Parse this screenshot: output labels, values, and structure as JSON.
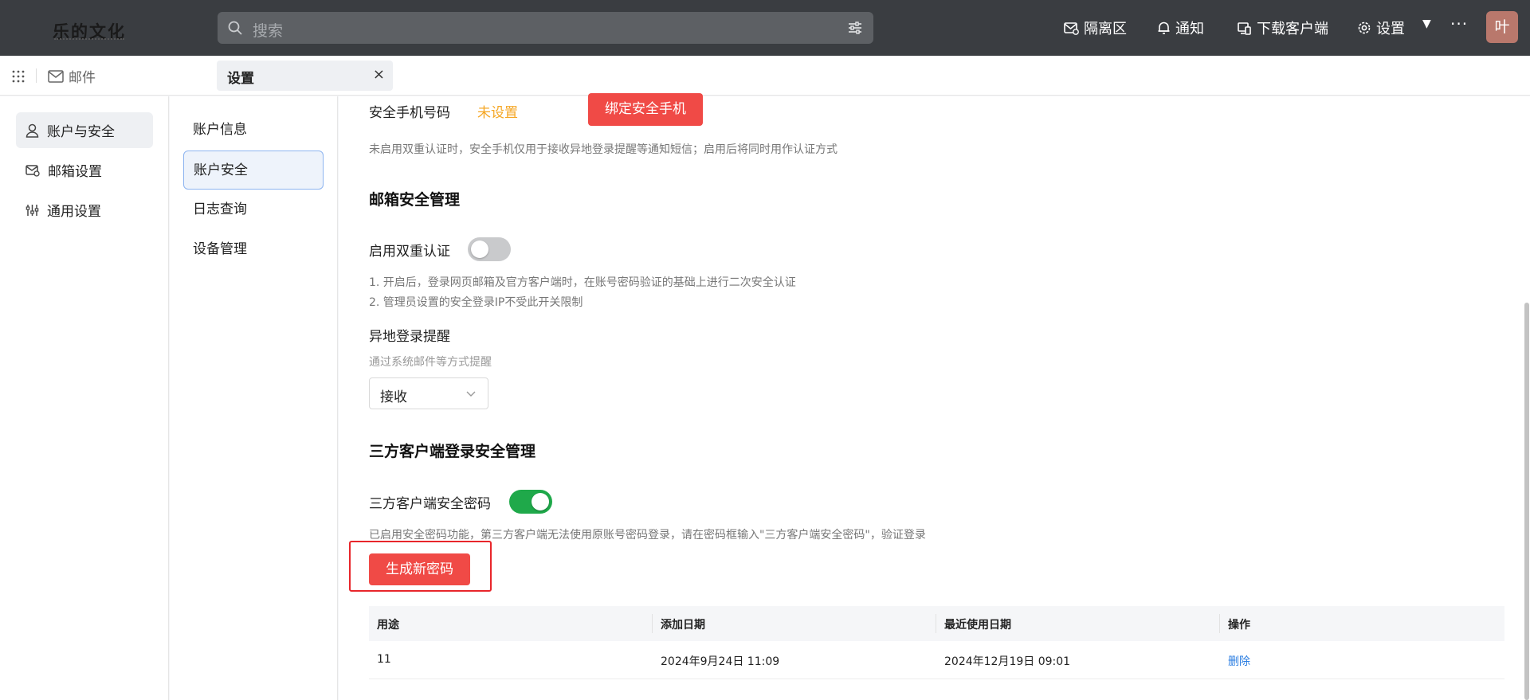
{
  "app": {
    "logo_text": "乐的文化",
    "search_placeholder": "搜索"
  },
  "top_nav": {
    "quarantine": "隔离区",
    "notifications": "通知",
    "download_client": "下载客户端",
    "settings": "设置",
    "more": "···",
    "avatar_initial": "叶"
  },
  "subbar": {
    "mail_tab": "邮件",
    "settings_tab": "设置",
    "close": "×"
  },
  "sidebar": {
    "items": [
      {
        "label": "账户与安全",
        "icon": "user-icon",
        "active": true
      },
      {
        "label": "邮箱设置",
        "icon": "mailbox-settings-icon",
        "active": false
      },
      {
        "label": "通用设置",
        "icon": "sliders-icon",
        "active": false
      }
    ]
  },
  "midmenu": {
    "items": [
      {
        "label": "账户信息",
        "active": false
      },
      {
        "label": "账户安全",
        "active": true
      },
      {
        "label": "日志查询",
        "active": false
      },
      {
        "label": "设备管理",
        "active": false
      }
    ]
  },
  "content": {
    "phone": {
      "label": "安全手机号码",
      "status": "未设置",
      "bind_button": "绑定安全手机",
      "note": "未启用双重认证时，安全手机仅用于接收异地登录提醒等通知短信；启用后将同时用作认证方式"
    },
    "mailbox_security": {
      "title": "邮箱安全管理",
      "two_factor_label": "启用双重认证",
      "two_factor_enabled": false,
      "notes": [
        "1. 开启后，登录网页邮箱及官方客户端时，在账号密码验证的基础上进行二次安全认证",
        "2. 管理员设置的安全登录IP不受此开关限制"
      ],
      "remote_login_label": "异地登录提醒",
      "remote_login_note": "通过系统邮件等方式提醒",
      "remote_login_value": "接收"
    },
    "third_party": {
      "title": "三方客户端登录安全管理",
      "password_label": "三方客户端安全密码",
      "password_enabled": true,
      "note": "已启用安全密码功能，第三方客户端无法使用原账号密码登录，请在密码框输入\"三方客户端安全密码\"，验证登录",
      "generate_button": "生成新密码",
      "table": {
        "headers": [
          "用途",
          "添加日期",
          "最近使用日期",
          "操作"
        ],
        "rows": [
          [
            "11",
            "2024年9月24日 11:09",
            "2024年12月19日 09:01",
            "删除"
          ]
        ]
      }
    }
  },
  "colors": {
    "topbar": "#3a3d41",
    "accent_red": "#f04a46",
    "warning_orange": "#f5a623",
    "toggle_on": "#1fa94a",
    "link_blue": "#2a7de1"
  }
}
